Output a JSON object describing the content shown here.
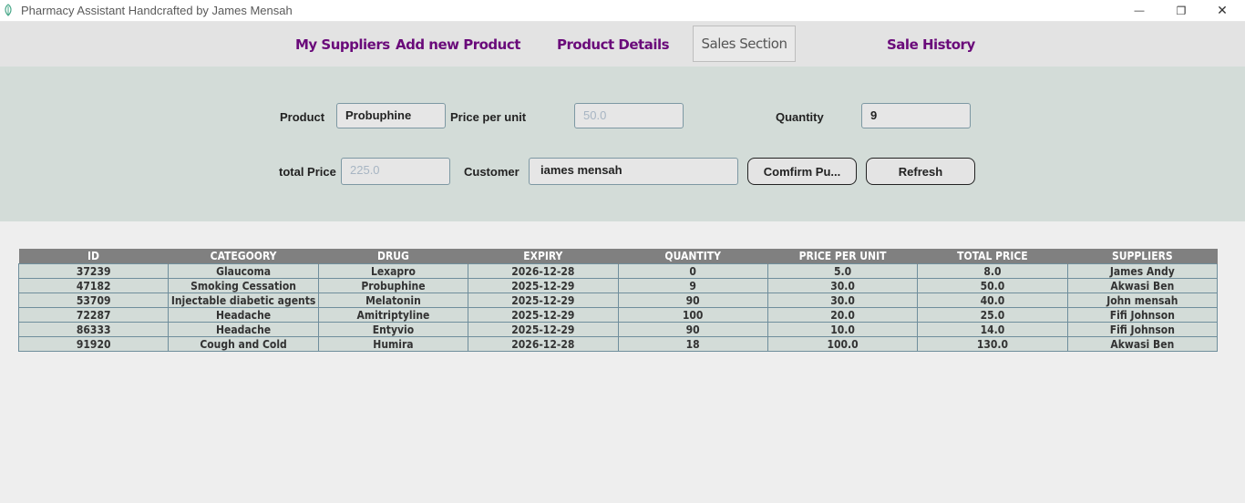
{
  "window": {
    "title": "Pharmacy Assistant Handcrafted by James Mensah",
    "icon": "app-leaf-icon",
    "minimize_glyph": "—",
    "maximize_glyph": "❐",
    "close_glyph": "✕"
  },
  "nav": {
    "my_suppliers": "My Suppliers",
    "add_new_product": "Add new Product",
    "product_details": "Product Details",
    "sales_section": "Sales Section",
    "sale_history": "Sale History"
  },
  "form": {
    "product_label": "Product",
    "product_value": "Probuphine",
    "price_per_unit_label": "Price per unit",
    "price_per_unit_value": "50.0",
    "quantity_label": "Quantity",
    "quantity_value": "9",
    "total_price_label": "total Price",
    "total_price_value": "225.0",
    "customer_label": "Customer",
    "customer_value": "iames mensah",
    "confirm_button": "Comfirm Pu...",
    "refresh_button": "Refresh"
  },
  "table": {
    "headers": [
      "ID",
      "CATEGOORY",
      "DRUG",
      "EXPIRY",
      "QUANTITY",
      "PRICE PER UNIT",
      "TOTAL PRICE",
      "SUPPLIERS"
    ],
    "rows": [
      [
        "37239",
        "Glaucoma",
        "Lexapro",
        "2026-12-28",
        "0",
        "5.0",
        "8.0",
        "James Andy"
      ],
      [
        "47182",
        "Smoking Cessation",
        "Probuphine",
        "2025-12-29",
        "9",
        "30.0",
        "50.0",
        "Akwasi Ben"
      ],
      [
        "53709",
        "Injectable diabetic agents",
        "Melatonin",
        "2025-12-29",
        "90",
        "30.0",
        "40.0",
        "John mensah"
      ],
      [
        "72287",
        "Headache",
        "Amitriptyline",
        "2025-12-29",
        "100",
        "20.0",
        "25.0",
        "Fifi Johnson"
      ],
      [
        "86333",
        "Headache",
        "Entyvio",
        "2025-12-29",
        "90",
        "10.0",
        "14.0",
        "Fifi Johnson"
      ],
      [
        "91920",
        "Cough and Cold",
        "Humira",
        "2026-12-28",
        "18",
        "100.0",
        "130.0",
        "Akwasi Ben"
      ]
    ]
  }
}
